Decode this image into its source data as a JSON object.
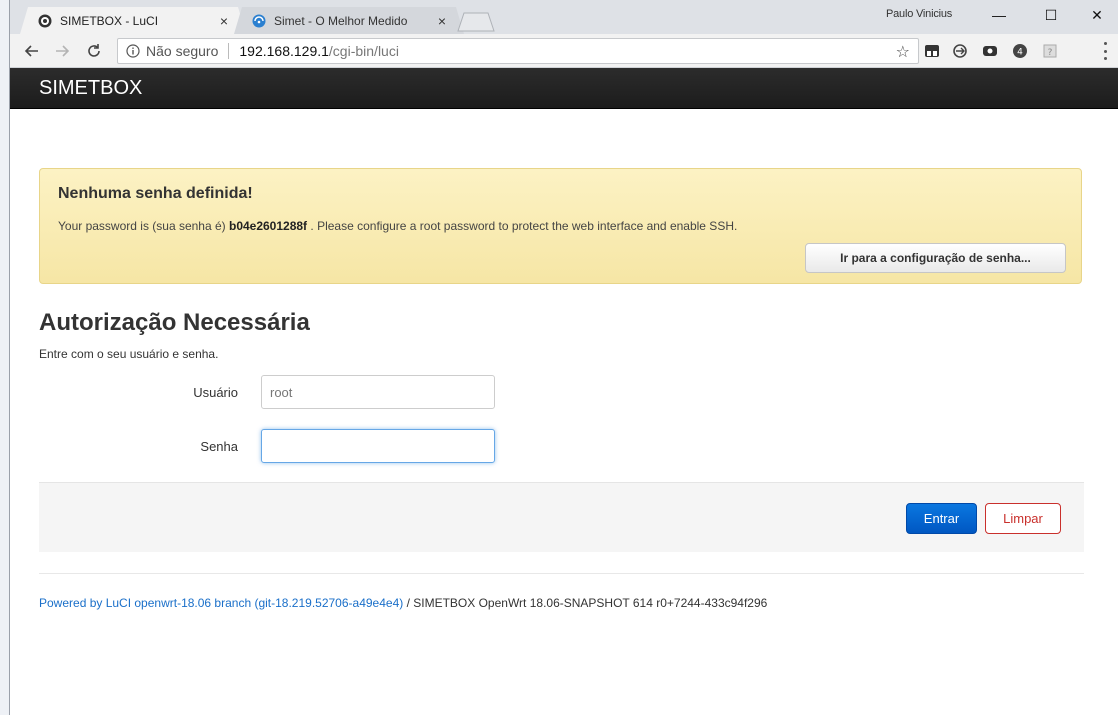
{
  "browser": {
    "tabs": [
      {
        "title": "SIMETBOX - LuCI",
        "active": true
      },
      {
        "title": "Simet - O Melhor Medido",
        "active": false
      }
    ],
    "tab_close": "×",
    "user": "Paulo Vinicius",
    "window_controls": {
      "minimize": "—",
      "maximize": "☐",
      "close": "✕"
    },
    "address": {
      "security": "Não seguro",
      "host": "192.168.129.1",
      "path": "/cgi-bin/luci"
    }
  },
  "page": {
    "brand": "SIMETBOX",
    "alert": {
      "title": "Nenhuma senha definida!",
      "text_before": "Your password is (sua senha é) ",
      "password": "b04e2601288f",
      "text_after": " . Please configure a root password to protect the web interface and enable SSH.",
      "button": "Ir para a configuração de senha..."
    },
    "auth": {
      "title": "Autorização Necessária",
      "description": "Entre com o seu usuário e senha.",
      "username_label": "Usuário",
      "username_value": "root",
      "password_label": "Senha",
      "password_value": "",
      "login_button": "Entrar",
      "clear_button": "Limpar"
    },
    "footer": {
      "link": "Powered by LuCI openwrt-18.06 branch (git-18.219.52706-a49e4e4)",
      "text": " / SIMETBOX OpenWrt 18.06-SNAPSHOT 614 r0+7244-433c94f296"
    }
  },
  "colors": {
    "header": "#1f1f1f",
    "alert_bg": "#fbeeb9",
    "primary_button": "#0a6ad8",
    "danger": "#c9302c",
    "link": "#1a6fc9"
  }
}
